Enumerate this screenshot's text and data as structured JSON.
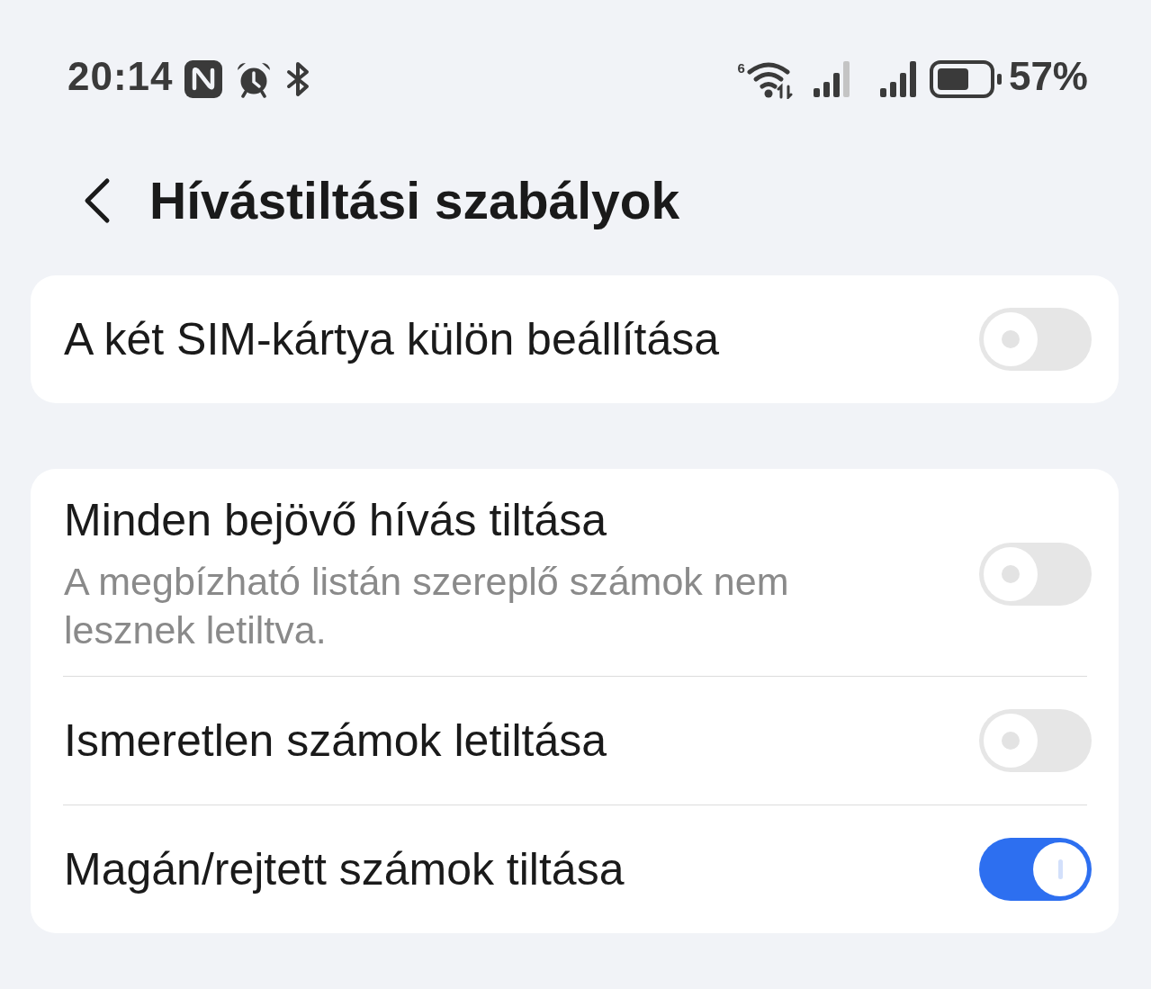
{
  "status_bar": {
    "time": "20:14",
    "wifi_generation": "6",
    "battery_percent": "57%"
  },
  "header": {
    "title": "Hívástiltási szabályok"
  },
  "groups": [
    {
      "items": [
        {
          "title": "A két SIM-kártya külön beállítása",
          "on": false
        }
      ]
    },
    {
      "items": [
        {
          "title": "Minden bejövő hívás tiltása",
          "subtitle": "A megbízható listán szereplő számok nem lesznek letiltva.",
          "on": false
        },
        {
          "title": "Ismeretlen számok letiltása",
          "on": false
        },
        {
          "title": "Magán/rejtett számok tiltása",
          "on": true
        }
      ]
    }
  ]
}
